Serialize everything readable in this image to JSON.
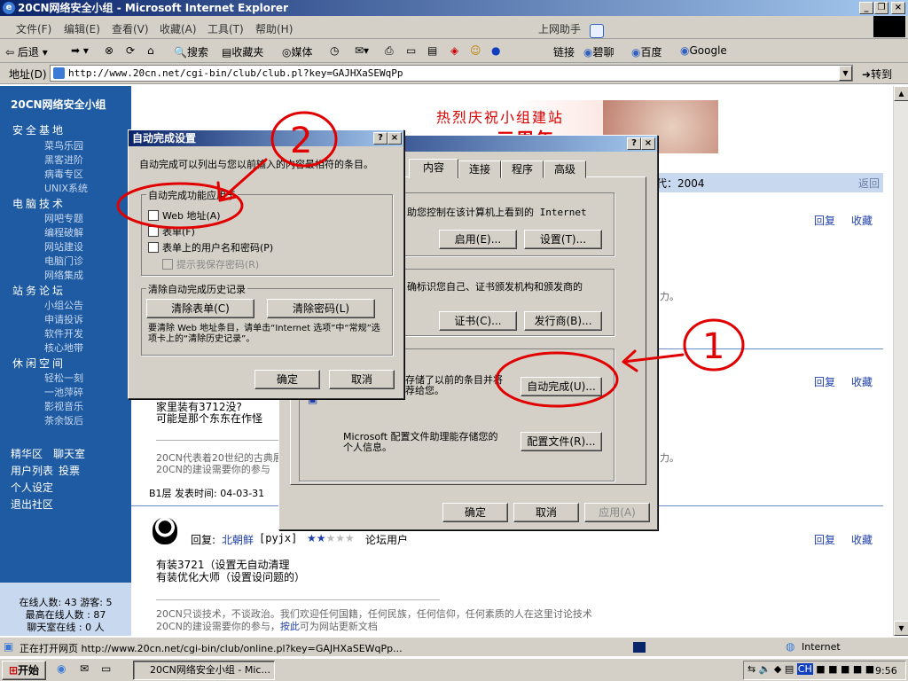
{
  "window": {
    "title": "20CN网络安全小组 - Microsoft Internet Explorer"
  },
  "menubar": {
    "items": [
      "文件(F)",
      "编辑(E)",
      "查看(V)",
      "收藏(A)",
      "工具(T)",
      "帮助(H)"
    ],
    "assistant": "上网助手"
  },
  "toolbar": {
    "back": "后退",
    "search": "搜索",
    "favorites": "收藏夹",
    "media": "媒体",
    "links_label": "链接",
    "links": [
      "碧聊",
      "百度",
      "Google"
    ]
  },
  "addressbar": {
    "label": "地址(D)",
    "url": "http://www.20cn.net/cgi-bin/club/club.pl?key=GAJHXaSEWqPp",
    "go": "转到"
  },
  "sidebar": {
    "title": "20CN网络安全小组",
    "groups": [
      {
        "name": "安全基地",
        "items": [
          "菜鸟乐园",
          "黑客进阶",
          "病毒专区",
          "UNIX系统"
        ]
      },
      {
        "name": "电脑技术",
        "items": [
          "网吧专题",
          "编程破解",
          "网站建设",
          "电脑门诊",
          "网络集成"
        ]
      },
      {
        "name": "站务论坛",
        "items": [
          "小组公告",
          "申请投诉",
          "软件开发",
          "核心地带"
        ]
      },
      {
        "name": "休闲空间",
        "items": [
          "轻松一刻",
          "一池萍碎",
          "影视音乐",
          "茶余饭后"
        ]
      }
    ],
    "links": [
      "精华区",
      "聊天室",
      "用户列表",
      "投票",
      "个人设定",
      "退出社区"
    ],
    "online": "在线人数: 43 游客: 5",
    "max_online": "最高在线人数 : 87",
    "chat_online": "聊天室在线 : 0 人"
  },
  "page": {
    "banner": "热烈庆祝小组建站",
    "banner_sub": "三周年",
    "stripe_text": "代：2004",
    "back_link": "返回",
    "reply": "回复",
    "collect": "收藏",
    "frag1": "力。",
    "post1_line1": "家里装有3712没?",
    "post1_line2": "可能是那个东东在作怪",
    "sig1_line1": "20CN代表着20世纪的古典展",
    "sig1_line2": "20CN的建设需要你的参与",
    "sig1_tail": "力。",
    "floor": "B1层 发表时间: 04-03-31",
    "reply_label": "回复:",
    "reply_user": "北朝鲜",
    "reply_id": "[pyjx]",
    "reply_rank": "论坛用户",
    "post2_line1": "有装3721（设置无自动清理",
    "post2_line2": "有装优化大师（设置设问题的）",
    "sig2_line1": "20CN只谈技术，不谈政治。我们欢迎任何国籍，任何民族，任何信仰，任何素质的人在这里讨论技术",
    "sig2_line2a": "20CN的建设需要你的参与，",
    "sig2_link": "按此",
    "sig2_line2b": "可为网站更新文档"
  },
  "options_dialog": {
    "tabs": [
      "内容",
      "连接",
      "程序",
      "高级"
    ],
    "content_advisor_text": "助您控制在该计算机上看到的 Internet",
    "enable_btn": "启用(E)...",
    "settings_btn": "设置(T)...",
    "cert_text": "确标识您自己、证书颁发机构和颁发商的",
    "cert_btn": "证书(C)...",
    "publisher_btn": "发行商(B)...",
    "autocomplete_text": "存储了以前的条目并将\n荐给您。",
    "autocomplete_btn": "自动完成(U)...",
    "profile_text": "Microsoft 配置文件助理能存储您的\n个人信息。",
    "profile_btn": "配置文件(R)...",
    "ok": "确定",
    "cancel": "取消",
    "apply": "应用(A)"
  },
  "autocomplete_dialog": {
    "title": "自动完成设置",
    "desc": "自动完成可以列出与您以前输入的内容最相符的条目。",
    "use_for": "自动完成功能应用于",
    "options": [
      "Web 地址(A)",
      "表单(F)",
      "表单上的用户名和密码(P)"
    ],
    "prompt_save": "提示我保存密码(R)",
    "clear_group": "清除自动完成历史记录",
    "clear_forms": "清除表单(C)",
    "clear_passwords": "清除密码(L)",
    "clear_note": "要清除 Web 地址条目，请单击“Internet 选项”中“常规”选项卡上的“清除历史记录”。",
    "ok": "确定",
    "cancel": "取消"
  },
  "annotations": [
    "1",
    "2"
  ],
  "statusbar": {
    "text": "正在打开网页 http://www.20cn.net/cgi-bin/club/online.pl?key=GAJHXaSEWqPp...",
    "zone": "Internet"
  },
  "taskbar": {
    "start": "开始",
    "task": "20CN网络安全小组 - Mic...",
    "time": "9:56"
  },
  "colors": {
    "titlebar": "#0a246a",
    "sidebar": "#1e5ba2",
    "annotation": "#e00000"
  }
}
